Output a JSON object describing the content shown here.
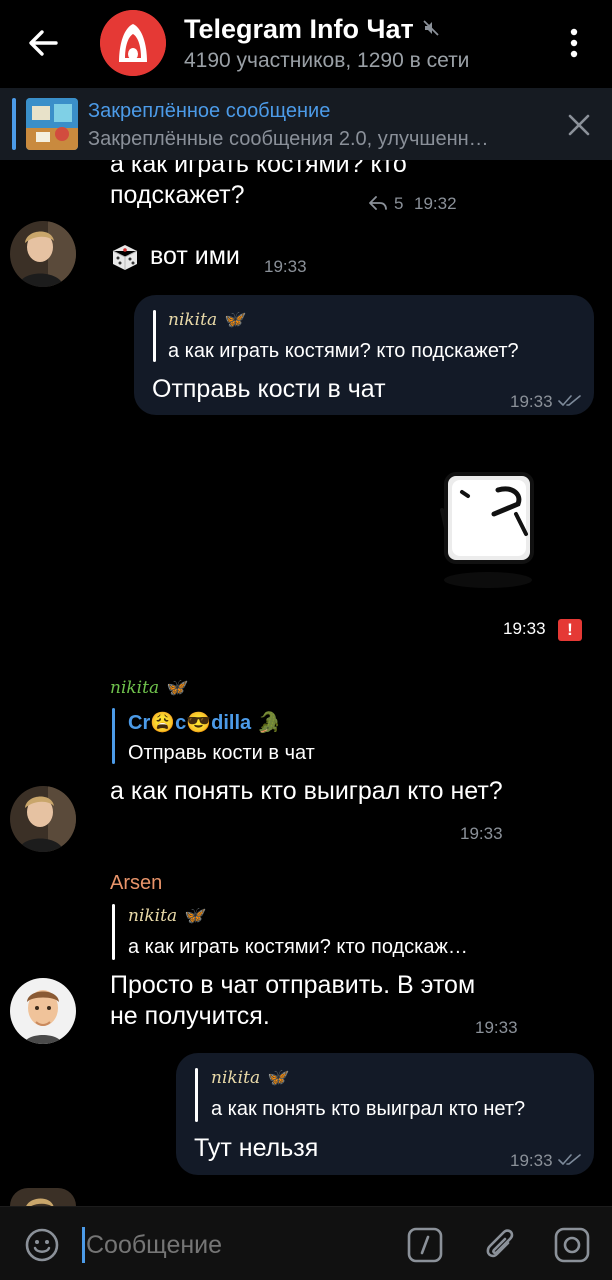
{
  "header": {
    "title": "Telegram Info Чат",
    "subtitle": "4190 участников, 1290 в сети"
  },
  "pinned": {
    "title": "Закреплённое сообщение",
    "text": "Закреплённые сообщения 2.0, улучшенн…"
  },
  "messages": {
    "m1": {
      "text": "а как играть костями? кто подскажет?",
      "reply_count": "5",
      "time": "19:32"
    },
    "m2": {
      "emoji": "🎲",
      "text": "вот ими",
      "time": "19:33"
    },
    "m3": {
      "quote_name": "nikita 🦋",
      "quote_text": "а как играть костями? кто подскажет?",
      "text": "Отправь кости в чат",
      "time": "19:33"
    },
    "m4": {
      "time": "19:33",
      "error": "!"
    },
    "m5": {
      "sender": "nikita 🦋",
      "quote_name": "Cr😩c😎dilla 🐊",
      "quote_text": "Отправь кости в чат",
      "text": "а как понять кто выиграл кто нет?",
      "time": "19:33"
    },
    "m6": {
      "sender": "Arsen",
      "quote_name": "nikita 🦋",
      "quote_text": "а как играть костями? кто подскаж…",
      "text": "Просто в чат отправить. В этом не получится.",
      "time": "19:33"
    },
    "m7": {
      "quote_name": "nikita 🦋",
      "quote_text": "а как понять кто выиграл кто нет?",
      "text": "Тут нельзя",
      "time": "19:33"
    }
  },
  "input": {
    "placeholder": "Сообщение"
  },
  "colors": {
    "accent": "#4c9be8",
    "bubble_out": "#131a27",
    "sender_nikita": "#6fc24c",
    "sender_arsen": "#e8946a",
    "error": "#e53935"
  },
  "icons": [
    "back-arrow-icon",
    "mute-icon",
    "more-vert-icon",
    "close-icon",
    "reply-icon",
    "double-check-icon",
    "error-icon",
    "emoji-icon",
    "slash-command-icon",
    "paperclip-icon",
    "camera-icon"
  ]
}
